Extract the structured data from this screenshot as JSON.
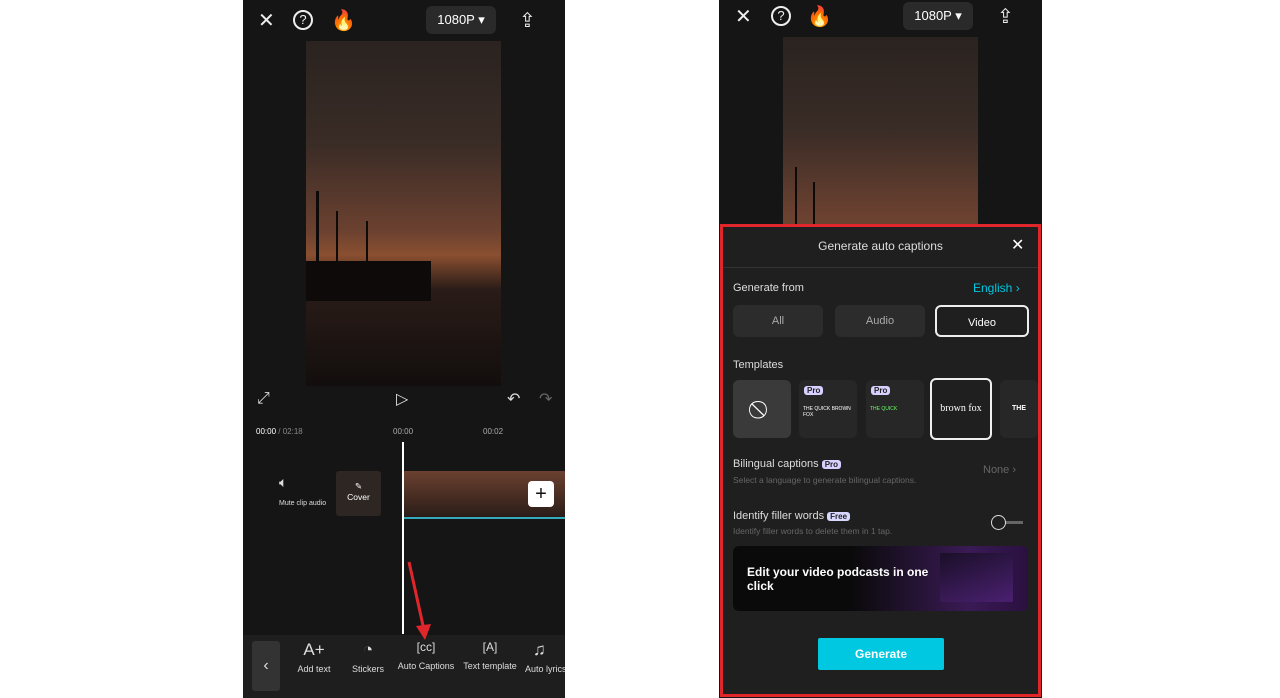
{
  "left": {
    "resolution": "1080P",
    "time_current": "00:00",
    "time_total": "/ 02:18",
    "ticks": [
      "00:00",
      "00:02"
    ],
    "mute_label": "Mute clip audio",
    "cover_label": "Cover",
    "toolbar": [
      {
        "label": "Add text",
        "icon": "A+"
      },
      {
        "label": "Stickers",
        "icon": "◔"
      },
      {
        "label": "Auto Captions",
        "icon": "[cc]"
      },
      {
        "label": "Text template",
        "icon": "[A]"
      },
      {
        "label": "Auto lyrics",
        "icon": "♫"
      }
    ]
  },
  "right": {
    "resolution": "1080P",
    "panel": {
      "title": "Generate auto captions",
      "generate_from": "Generate from",
      "language": "English",
      "sources": [
        "All",
        "Audio",
        "Video"
      ],
      "selected_source": "Video",
      "templates_label": "Templates",
      "templates": [
        {
          "badge": "",
          "text": ""
        },
        {
          "badge": "Pro",
          "text": "THE QUICK BROWN FOX"
        },
        {
          "badge": "Pro",
          "text": "THE QUICK"
        },
        {
          "badge": "",
          "text": "brown fox"
        },
        {
          "badge": "",
          "text": "THE QU"
        }
      ],
      "bilingual": {
        "label": "Bilingual captions",
        "badge": "Pro",
        "sub": "Select a language to generate bilingual captions.",
        "value": "None"
      },
      "filler": {
        "label": "Identify filler words",
        "badge": "Free",
        "sub": "Identify filler words to delete them in 1 tap.",
        "enabled": false
      },
      "banner": "Edit your video podcasts in one click",
      "generate_button": "Generate"
    }
  },
  "colors": {
    "accent": "#00c8e0",
    "highlight": "#e0262b"
  }
}
